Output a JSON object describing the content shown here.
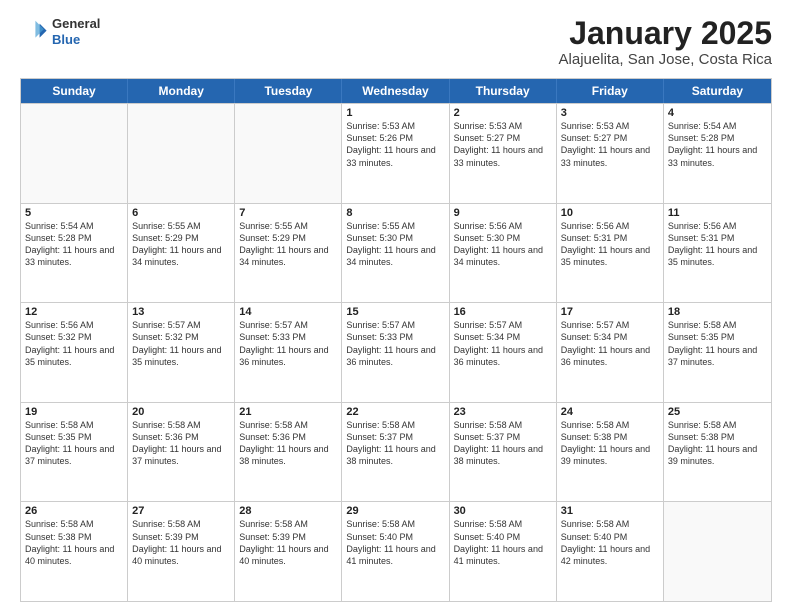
{
  "header": {
    "logo": {
      "general": "General",
      "blue": "Blue"
    },
    "title": "January 2025",
    "location": "Alajuelita, San Jose, Costa Rica"
  },
  "weekdays": [
    "Sunday",
    "Monday",
    "Tuesday",
    "Wednesday",
    "Thursday",
    "Friday",
    "Saturday"
  ],
  "rows": [
    [
      {
        "day": "",
        "sunrise": "",
        "sunset": "",
        "daylight": ""
      },
      {
        "day": "",
        "sunrise": "",
        "sunset": "",
        "daylight": ""
      },
      {
        "day": "",
        "sunrise": "",
        "sunset": "",
        "daylight": ""
      },
      {
        "day": "1",
        "sunrise": "Sunrise: 5:53 AM",
        "sunset": "Sunset: 5:26 PM",
        "daylight": "Daylight: 11 hours and 33 minutes."
      },
      {
        "day": "2",
        "sunrise": "Sunrise: 5:53 AM",
        "sunset": "Sunset: 5:27 PM",
        "daylight": "Daylight: 11 hours and 33 minutes."
      },
      {
        "day": "3",
        "sunrise": "Sunrise: 5:53 AM",
        "sunset": "Sunset: 5:27 PM",
        "daylight": "Daylight: 11 hours and 33 minutes."
      },
      {
        "day": "4",
        "sunrise": "Sunrise: 5:54 AM",
        "sunset": "Sunset: 5:28 PM",
        "daylight": "Daylight: 11 hours and 33 minutes."
      }
    ],
    [
      {
        "day": "5",
        "sunrise": "Sunrise: 5:54 AM",
        "sunset": "Sunset: 5:28 PM",
        "daylight": "Daylight: 11 hours and 33 minutes."
      },
      {
        "day": "6",
        "sunrise": "Sunrise: 5:55 AM",
        "sunset": "Sunset: 5:29 PM",
        "daylight": "Daylight: 11 hours and 34 minutes."
      },
      {
        "day": "7",
        "sunrise": "Sunrise: 5:55 AM",
        "sunset": "Sunset: 5:29 PM",
        "daylight": "Daylight: 11 hours and 34 minutes."
      },
      {
        "day": "8",
        "sunrise": "Sunrise: 5:55 AM",
        "sunset": "Sunset: 5:30 PM",
        "daylight": "Daylight: 11 hours and 34 minutes."
      },
      {
        "day": "9",
        "sunrise": "Sunrise: 5:56 AM",
        "sunset": "Sunset: 5:30 PM",
        "daylight": "Daylight: 11 hours and 34 minutes."
      },
      {
        "day": "10",
        "sunrise": "Sunrise: 5:56 AM",
        "sunset": "Sunset: 5:31 PM",
        "daylight": "Daylight: 11 hours and 35 minutes."
      },
      {
        "day": "11",
        "sunrise": "Sunrise: 5:56 AM",
        "sunset": "Sunset: 5:31 PM",
        "daylight": "Daylight: 11 hours and 35 minutes."
      }
    ],
    [
      {
        "day": "12",
        "sunrise": "Sunrise: 5:56 AM",
        "sunset": "Sunset: 5:32 PM",
        "daylight": "Daylight: 11 hours and 35 minutes."
      },
      {
        "day": "13",
        "sunrise": "Sunrise: 5:57 AM",
        "sunset": "Sunset: 5:32 PM",
        "daylight": "Daylight: 11 hours and 35 minutes."
      },
      {
        "day": "14",
        "sunrise": "Sunrise: 5:57 AM",
        "sunset": "Sunset: 5:33 PM",
        "daylight": "Daylight: 11 hours and 36 minutes."
      },
      {
        "day": "15",
        "sunrise": "Sunrise: 5:57 AM",
        "sunset": "Sunset: 5:33 PM",
        "daylight": "Daylight: 11 hours and 36 minutes."
      },
      {
        "day": "16",
        "sunrise": "Sunrise: 5:57 AM",
        "sunset": "Sunset: 5:34 PM",
        "daylight": "Daylight: 11 hours and 36 minutes."
      },
      {
        "day": "17",
        "sunrise": "Sunrise: 5:57 AM",
        "sunset": "Sunset: 5:34 PM",
        "daylight": "Daylight: 11 hours and 36 minutes."
      },
      {
        "day": "18",
        "sunrise": "Sunrise: 5:58 AM",
        "sunset": "Sunset: 5:35 PM",
        "daylight": "Daylight: 11 hours and 37 minutes."
      }
    ],
    [
      {
        "day": "19",
        "sunrise": "Sunrise: 5:58 AM",
        "sunset": "Sunset: 5:35 PM",
        "daylight": "Daylight: 11 hours and 37 minutes."
      },
      {
        "day": "20",
        "sunrise": "Sunrise: 5:58 AM",
        "sunset": "Sunset: 5:36 PM",
        "daylight": "Daylight: 11 hours and 37 minutes."
      },
      {
        "day": "21",
        "sunrise": "Sunrise: 5:58 AM",
        "sunset": "Sunset: 5:36 PM",
        "daylight": "Daylight: 11 hours and 38 minutes."
      },
      {
        "day": "22",
        "sunrise": "Sunrise: 5:58 AM",
        "sunset": "Sunset: 5:37 PM",
        "daylight": "Daylight: 11 hours and 38 minutes."
      },
      {
        "day": "23",
        "sunrise": "Sunrise: 5:58 AM",
        "sunset": "Sunset: 5:37 PM",
        "daylight": "Daylight: 11 hours and 38 minutes."
      },
      {
        "day": "24",
        "sunrise": "Sunrise: 5:58 AM",
        "sunset": "Sunset: 5:38 PM",
        "daylight": "Daylight: 11 hours and 39 minutes."
      },
      {
        "day": "25",
        "sunrise": "Sunrise: 5:58 AM",
        "sunset": "Sunset: 5:38 PM",
        "daylight": "Daylight: 11 hours and 39 minutes."
      }
    ],
    [
      {
        "day": "26",
        "sunrise": "Sunrise: 5:58 AM",
        "sunset": "Sunset: 5:38 PM",
        "daylight": "Daylight: 11 hours and 40 minutes."
      },
      {
        "day": "27",
        "sunrise": "Sunrise: 5:58 AM",
        "sunset": "Sunset: 5:39 PM",
        "daylight": "Daylight: 11 hours and 40 minutes."
      },
      {
        "day": "28",
        "sunrise": "Sunrise: 5:58 AM",
        "sunset": "Sunset: 5:39 PM",
        "daylight": "Daylight: 11 hours and 40 minutes."
      },
      {
        "day": "29",
        "sunrise": "Sunrise: 5:58 AM",
        "sunset": "Sunset: 5:40 PM",
        "daylight": "Daylight: 11 hours and 41 minutes."
      },
      {
        "day": "30",
        "sunrise": "Sunrise: 5:58 AM",
        "sunset": "Sunset: 5:40 PM",
        "daylight": "Daylight: 11 hours and 41 minutes."
      },
      {
        "day": "31",
        "sunrise": "Sunrise: 5:58 AM",
        "sunset": "Sunset: 5:40 PM",
        "daylight": "Daylight: 11 hours and 42 minutes."
      },
      {
        "day": "",
        "sunrise": "",
        "sunset": "",
        "daylight": ""
      }
    ]
  ]
}
